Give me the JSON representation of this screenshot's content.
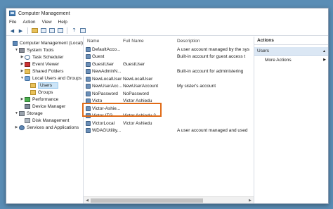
{
  "window": {
    "title": "Computer Management"
  },
  "menu": [
    "File",
    "Action",
    "View",
    "Help"
  ],
  "tree": [
    {
      "label": "Computer Management (Local)",
      "indent": 0,
      "arrow": "",
      "icon": "pc-icon"
    },
    {
      "label": "System Tools",
      "indent": 1,
      "arrow": "▼",
      "icon": "tools-icon"
    },
    {
      "label": "Task Scheduler",
      "indent": 2,
      "arrow": "▶",
      "icon": "clock-icon"
    },
    {
      "label": "Event Viewer",
      "indent": 2,
      "arrow": "▶",
      "icon": "event-icon"
    },
    {
      "label": "Shared Folders",
      "indent": 2,
      "arrow": "▶",
      "icon": "folder-icon"
    },
    {
      "label": "Local Users and Groups",
      "indent": 2,
      "arrow": "▼",
      "icon": "users-icon"
    },
    {
      "label": "Users",
      "indent": 3,
      "arrow": "",
      "icon": "folder-icon",
      "selected": true
    },
    {
      "label": "Groups",
      "indent": 3,
      "arrow": "",
      "icon": "folder-icon"
    },
    {
      "label": "Performance",
      "indent": 2,
      "arrow": "▶",
      "icon": "perf-icon"
    },
    {
      "label": "Device Manager",
      "indent": 2,
      "arrow": "",
      "icon": "device-icon"
    },
    {
      "label": "Storage",
      "indent": 1,
      "arrow": "▼",
      "icon": "storage-icon"
    },
    {
      "label": "Disk Management",
      "indent": 2,
      "arrow": "",
      "icon": "disk-icon"
    },
    {
      "label": "Services and Applications",
      "indent": 1,
      "arrow": "▶",
      "icon": "services-icon"
    }
  ],
  "columns": {
    "name": "Name",
    "full_name": "Full Name",
    "description": "Description"
  },
  "users": [
    {
      "name": "DefaultAcco...",
      "full": "",
      "desc": "A user account managed by the sys"
    },
    {
      "name": "Guest",
      "full": "",
      "desc": "Built-in account for guest access t"
    },
    {
      "name": "GuestUser",
      "full": "GuestUser",
      "desc": ""
    },
    {
      "name": "NewAdminN...",
      "full": "",
      "desc": "Built-in account for administering"
    },
    {
      "name": "NewLocalUser",
      "full": "NewLocalUser",
      "desc": ""
    },
    {
      "name": "NewUserAcc...",
      "full": "NewUserAccount",
      "desc": "My sister's account"
    },
    {
      "name": "NoPassword",
      "full": "NoPassword",
      "desc": ""
    },
    {
      "name": "Victo",
      "full": "Victor Ashiedu",
      "desc": ""
    },
    {
      "name": "Victor-Ashie...",
      "full": "",
      "desc": ""
    },
    {
      "name": "Victor-ITG",
      "full": "Victor Ashiedu 2",
      "desc": ""
    },
    {
      "name": "VictorLocal",
      "full": "Victor Ashiedu",
      "desc": ""
    },
    {
      "name": "WDAGUtility...",
      "full": "",
      "desc": "A user account managed and used"
    }
  ],
  "actions": {
    "header": "Actions",
    "section": "Users",
    "items": [
      "More Actions"
    ]
  },
  "colors": {
    "highlight": "#e06a16",
    "selection": "#cce4f7",
    "desktop": "#5a8db5"
  }
}
